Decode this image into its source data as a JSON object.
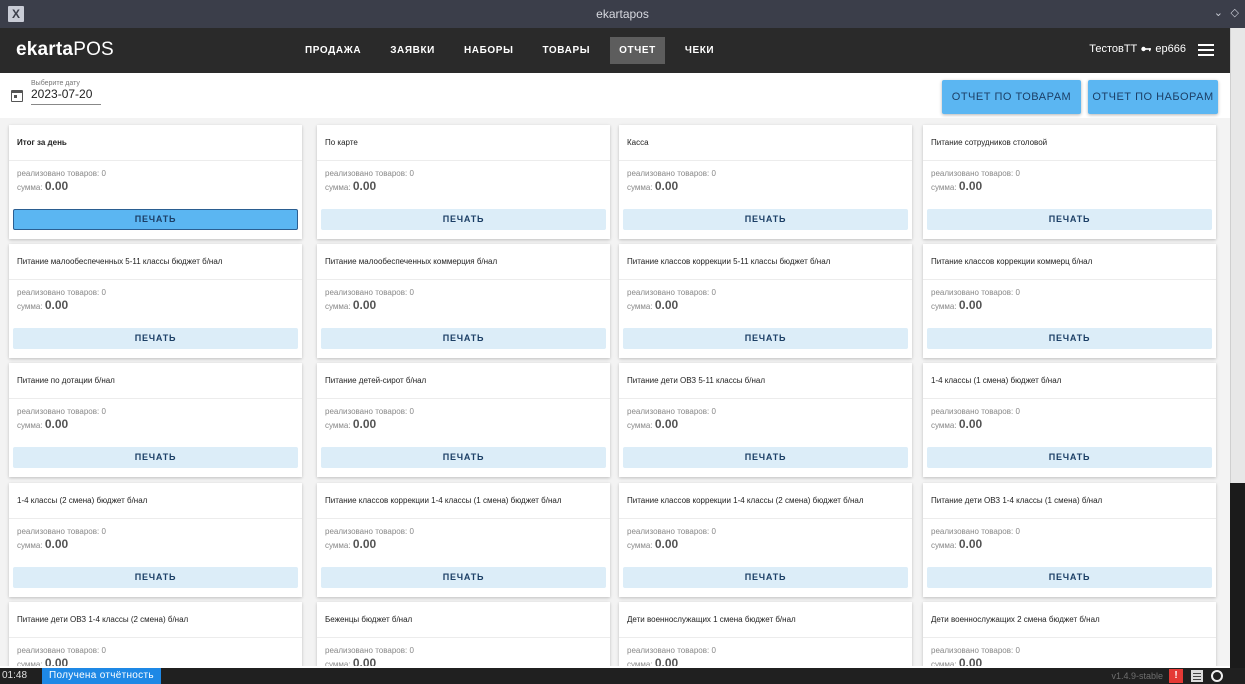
{
  "window": {
    "title": "ekartapos",
    "app_icon": "X",
    "controls": [
      "⌄",
      "◇"
    ]
  },
  "appbar": {
    "brand_bold": "ekarta",
    "brand_light": "POS",
    "nav": [
      {
        "label": "ПРОДАЖА",
        "active": false
      },
      {
        "label": "ЗАЯВКИ",
        "active": false
      },
      {
        "label": "НАБОРЫ",
        "active": false
      },
      {
        "label": "ТОВАРЫ",
        "active": false
      },
      {
        "label": "ОТЧЕТ",
        "active": true
      },
      {
        "label": "ЧЕКИ",
        "active": false
      }
    ],
    "user": "ТестовТТ",
    "user_icon": "key-icon",
    "user_code": "ep666"
  },
  "date_field": {
    "label": "Выберите дату",
    "value": "2023-07-20"
  },
  "actions": {
    "goods_report": "ОТЧЕТ ПО ТОВАРАМ",
    "sets_report": "ОТЧЕТ ПО НАБОРАМ"
  },
  "card_labels": {
    "sold_prefix": "реализовано товаров: ",
    "sum_prefix": "сумма: ",
    "print": "ПЕЧАТЬ"
  },
  "cards": [
    {
      "title": "Итог за день",
      "sold": "0",
      "sum": "0.00",
      "bold": true,
      "active": true
    },
    {
      "title": "По карте",
      "sold": "0",
      "sum": "0.00"
    },
    {
      "title": "Касса",
      "sold": "0",
      "sum": "0.00"
    },
    {
      "title": "Питание сотрудников столовой",
      "sold": "0",
      "sum": "0.00"
    },
    {
      "title": "Питание малообеспеченных 5-11 классы бюджет б/нал",
      "sold": "0",
      "sum": "0.00"
    },
    {
      "title": "Питание малообеспеченных коммерция б/нал",
      "sold": "0",
      "sum": "0.00"
    },
    {
      "title": "Питание классов коррекции 5-11 классы бюджет б/нал",
      "sold": "0",
      "sum": "0.00"
    },
    {
      "title": "Питание классов коррекции коммерц б/нал",
      "sold": "0",
      "sum": "0.00"
    },
    {
      "title": "Питание по дотации б/нал",
      "sold": "0",
      "sum": "0.00"
    },
    {
      "title": "Питание детей-сирот б/нал",
      "sold": "0",
      "sum": "0.00"
    },
    {
      "title": "Питание дети ОВЗ 5-11 классы б/нал",
      "sold": "0",
      "sum": "0.00"
    },
    {
      "title": "1-4 классы (1 смена) бюджет б/нал",
      "sold": "0",
      "sum": "0.00"
    },
    {
      "title": "1-4 классы (2 смена) бюджет б/нал",
      "sold": "0",
      "sum": "0.00"
    },
    {
      "title": "Питание классов коррекции 1-4 классы (1 смена) бюджет б/нал",
      "sold": "0",
      "sum": "0.00"
    },
    {
      "title": "Питание классов коррекции 1-4 классы (2 смена) бюджет б/нал",
      "sold": "0",
      "sum": "0.00"
    },
    {
      "title": "Питание дети ОВЗ 1-4 классы (1 смена) б/нал",
      "sold": "0",
      "sum": "0.00"
    },
    {
      "title": "Питание дети ОВЗ 1-4 классы (2 смена) б/нал",
      "sold": "0",
      "sum": "0.00"
    },
    {
      "title": "Беженцы бюджет б/нал",
      "sold": "0",
      "sum": "0.00"
    },
    {
      "title": "Дети военнослужащих 1 смена бюджет б/нал",
      "sold": "0",
      "sum": "0.00"
    },
    {
      "title": "Дети военнослужащих 2 смена бюджет б/нал",
      "sold": "0",
      "sum": "0.00"
    }
  ],
  "statusbar": {
    "time": "01:48",
    "note": "Получена отчётность",
    "version": "v1.4.9-stable",
    "warn_icon": "warning-icon",
    "doc_icon": "document-icon",
    "ring_icon": "circle-icon"
  },
  "colors": {
    "appbar": "#2a2a2a",
    "accent": "#5bb6f2",
    "print_button": "#dcedf8",
    "status_note": "#1e88e5",
    "warning": "#e53935"
  }
}
